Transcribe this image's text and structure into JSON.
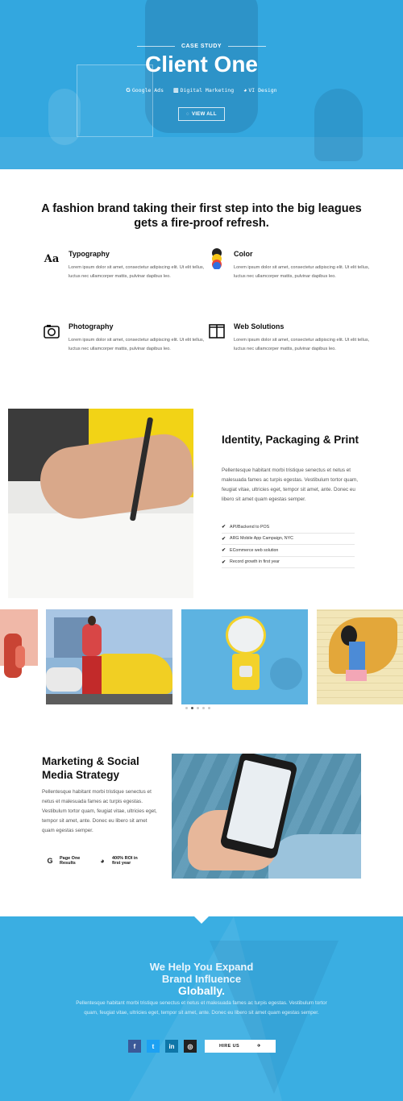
{
  "colors": {
    "primary_blue": "#33a7df",
    "cta_blue": "#3aaee2",
    "text_dark": "#111111",
    "text_body": "#555555"
  },
  "hero": {
    "eyebrow": "CASE STUDY",
    "title": "Client One",
    "tags": [
      {
        "icon": "google-icon",
        "glyph": "G",
        "label": "Google Ads"
      },
      {
        "icon": "bar-chart-icon",
        "glyph": "▥",
        "label": "Digital Marketing"
      },
      {
        "icon": "palette-icon",
        "glyph": "◕",
        "label": "VI Design"
      }
    ],
    "button": {
      "icon": "eye-icon",
      "glyph": "◌",
      "label": "VIEW ALL"
    }
  },
  "intro": {
    "heading": "A fashion brand taking their first step into the big leagues gets a fire-proof refresh."
  },
  "services": [
    {
      "icon": "typography-icon",
      "glyph": "Aa",
      "title": "Typography",
      "desc": "Lorem ipsum dolor sit amet, consectetur adipiscing elit. Ut elit tellus, luctus nec ullamcorper mattis, pulvinar dapibus leo."
    },
    {
      "icon": "color-swatches-icon",
      "glyph": "",
      "title": "Color",
      "desc": "Lorem ipsum dolor sit amet, consectetur adipiscing elit. Ut elit tellus, luctus nec ullamcorper mattis, pulvinar dapibus leo."
    },
    {
      "icon": "camera-icon",
      "glyph": "",
      "title": "Photography",
      "desc": "Lorem ipsum dolor sit amet, consectetur adipiscing elit. Ut elit tellus, luctus nec ullamcorper mattis, pulvinar dapibus leo."
    },
    {
      "icon": "layout-columns-icon",
      "glyph": "",
      "title": "Web Solutions",
      "desc": "Lorem ipsum dolor sit amet, consectetur adipiscing elit. Ut elit tellus, luctus nec ullamcorper mattis, pulvinar dapibus leo."
    }
  ],
  "identity": {
    "title": "Identity, Packaging & Print",
    "text": "Pellentesque habitant morbi tristique senectus et netus et malesuada fames ac turpis egestas. Vestibulum tortor quam, feugiat vitae, ultricies eget, tempor sit amet, ante. Donec eu libero sit amet quam egestas semper.",
    "list": [
      "API/Backend to POS",
      "ARG Mobile App Campaign, NYC",
      "ECommerce web solution",
      "Record growth in first year"
    ]
  },
  "gallery": {
    "slides": 4,
    "dots": 5,
    "active_dot": 1
  },
  "marketing": {
    "title": "Marketing & Social Media Strategy",
    "text": "Pellentesque habitant morbi tristique senectus et netus et malesuada fames ac turpis egestas. Vestibulum tortor quam, feugiat vitae, ultricies eget, tempor sit amet, ante. Donec eu libero sit amet quam egestas semper.",
    "stats": [
      {
        "icon": "google-icon",
        "glyph": "G",
        "label": "Page One Results"
      },
      {
        "icon": "pie-chart-icon",
        "glyph": "◕",
        "label": "400% ROI in first year"
      }
    ]
  },
  "cta": {
    "line1": "We Help You Expand",
    "line2": "Brand Influence",
    "line3": "Globally.",
    "text": "Pellentesque habitant morbi tristique senectus et netus et malesuada fames ac turpis egestas. Vestibulum tortor quam, feugiat vitae, ultricies eget, tempor sit amet, ante. Donec eu libero sit amet quam egestas semper.",
    "socials": [
      {
        "icon": "facebook-icon",
        "glyph": "f"
      },
      {
        "icon": "twitter-icon",
        "glyph": "t"
      },
      {
        "icon": "linkedin-icon",
        "glyph": "in"
      },
      {
        "icon": "instagram-icon",
        "glyph": "◎"
      }
    ],
    "hire_label": "HIRE US",
    "hire_icon": "send-icon",
    "hire_glyph": "✈"
  }
}
